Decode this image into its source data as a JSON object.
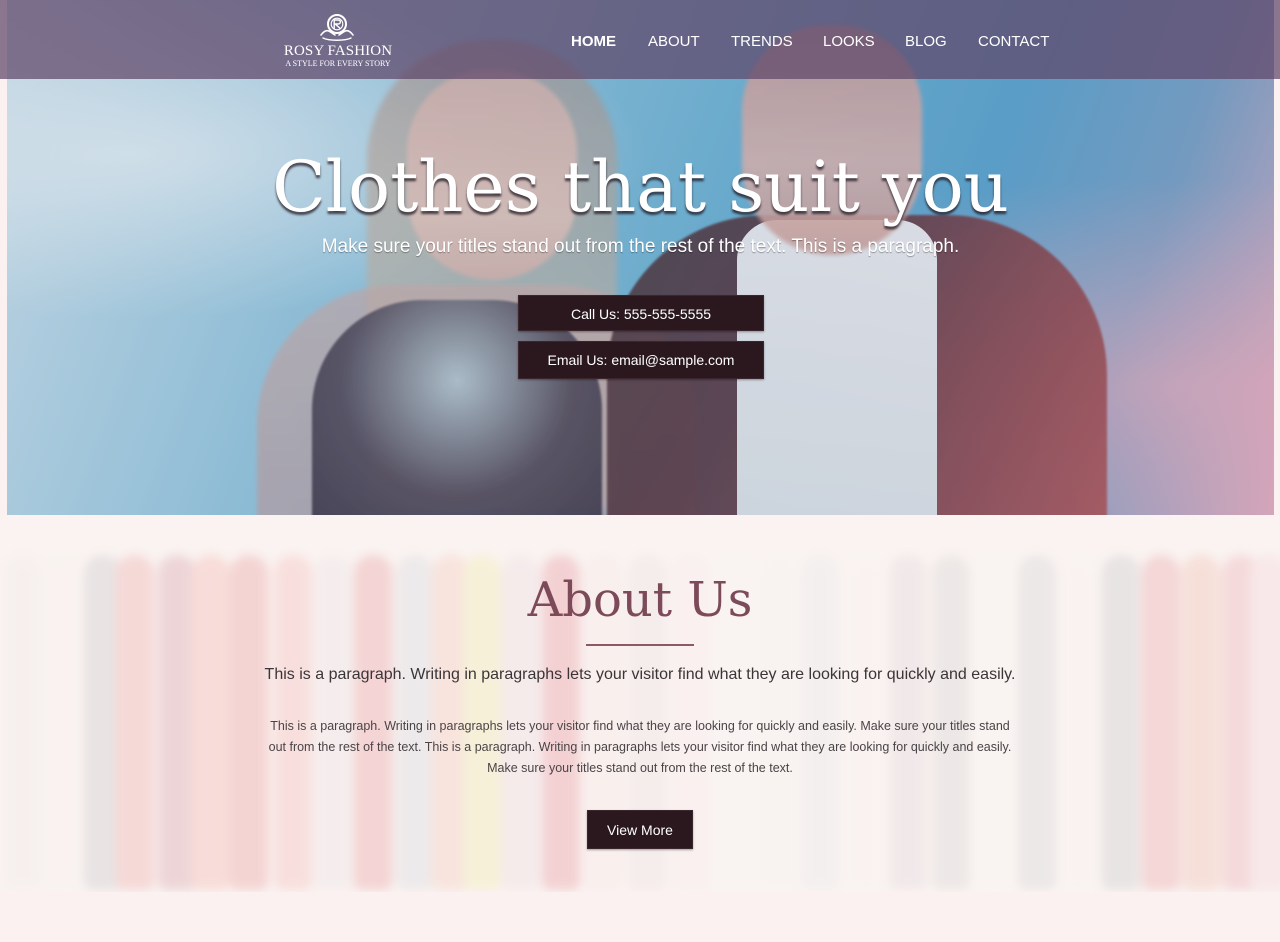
{
  "header": {
    "logo": {
      "title": "ROSY FASHION",
      "tagline": "A STYLE FOR EVERY STORY",
      "icon": "rose-monogram-icon"
    },
    "nav": {
      "home": "HOME",
      "about": "ABOUT",
      "trends": "TRENDS",
      "looks": "LOOKS",
      "blog": "BLOG",
      "contact": "CONTACT",
      "active": "HOME"
    }
  },
  "hero": {
    "title": "Clothes that suit you",
    "subtitle": "Make sure your titles stand out from the rest of the text. This is a paragraph.",
    "call_button": "Call Us: 555-555-5555",
    "email_button": "Email Us: email@sample.com"
  },
  "about": {
    "title": "About Us",
    "lead": "This is a paragraph. Writing in paragraphs lets your visitor find what they are looking for quickly and easily.",
    "body": "This is a paragraph. Writing in paragraphs lets your visitor find what they are looking for quickly and easily. Make sure your titles stand out from the rest of the text. This is a paragraph. Writing in paragraphs lets your visitor find what they are looking for quickly and easily. Make sure your titles stand out from the rest of the text.",
    "button": "View More"
  },
  "colors": {
    "header_overlay": "#5f4669",
    "button": "#2a181e",
    "about_title": "#7c4a59",
    "page_background": "#fbf1f0"
  }
}
